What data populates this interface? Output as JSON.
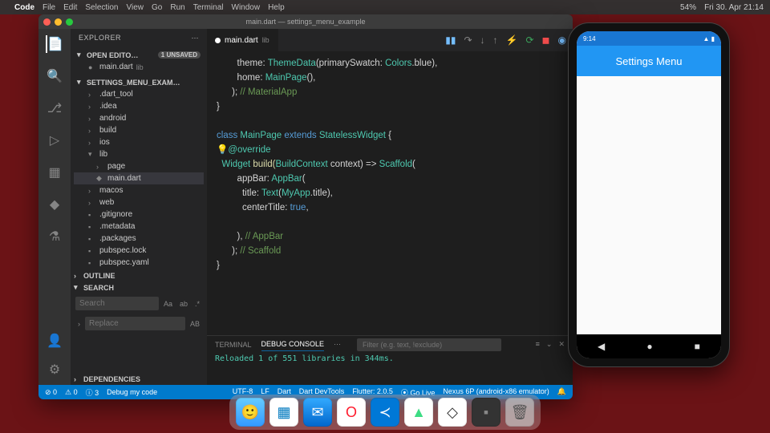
{
  "menubar": {
    "apple": "",
    "app": "Code",
    "items": [
      "File",
      "Edit",
      "Selection",
      "View",
      "Go",
      "Run",
      "Terminal",
      "Window",
      "Help"
    ],
    "right": {
      "time": "Fri 30. Apr 21:14",
      "bat": "54%"
    }
  },
  "vscode": {
    "title": "main.dart — settings_menu_example",
    "sidebar": {
      "header": "EXPLORER",
      "open_editors": {
        "label": "OPEN EDITO…",
        "badge": "1 UNSAVED",
        "file": "main.dart",
        "dir": "lib"
      },
      "project": {
        "label": "SETTINGS_MENU_EXAM…",
        "items": [
          {
            "name": ".dart_tool",
            "folder": true
          },
          {
            "name": ".idea",
            "folder": true
          },
          {
            "name": "android",
            "folder": true
          },
          {
            "name": "build",
            "folder": true
          },
          {
            "name": "ios",
            "folder": true
          },
          {
            "name": "lib",
            "folder": true,
            "open": true,
            "children": [
              {
                "name": "page",
                "folder": true
              },
              {
                "name": "main.dart",
                "folder": false,
                "selected": true
              }
            ]
          },
          {
            "name": "macos",
            "folder": true
          },
          {
            "name": "web",
            "folder": true
          },
          {
            "name": ".gitignore",
            "folder": false
          },
          {
            "name": ".metadata",
            "folder": false
          },
          {
            "name": ".packages",
            "folder": false
          },
          {
            "name": "pubspec.lock",
            "folder": false
          },
          {
            "name": "pubspec.yaml",
            "folder": false
          }
        ]
      },
      "outline": "OUTLINE",
      "search": "SEARCH",
      "search_ph": "Search",
      "replace_ph": "Replace",
      "dependencies": "DEPENDENCIES"
    },
    "tab": {
      "name": "main.dart",
      "dir": "lib"
    },
    "panel": {
      "terminal": "TERMINAL",
      "debug": "DEBUG CONSOLE",
      "filter_ph": "Filter (e.g. text, !exclude)",
      "log": "Reloaded 1 of 551 libraries in 344ms."
    },
    "status": {
      "left": [
        "⊘ 0",
        "⚠ 0",
        "ⓘ 3",
        "Debug my code"
      ],
      "right": [
        "UTF-8",
        "LF",
        "Dart",
        "Dart DevTools",
        "Flutter: 2.0.5",
        "⦿ Go Live",
        "Nexus 6P (android-x86 emulator)",
        "🔔"
      ]
    }
  },
  "phone": {
    "status_l": "9:14",
    "status_r": "▲ ▮",
    "appbar": "Settings Menu",
    "nav": [
      "◀",
      "●",
      "■"
    ]
  },
  "code": {
    "l1a": "        theme: ",
    "l1b": "ThemeData",
    "l1c": "(primarySwatch: ",
    "l1d": "Colors",
    "l1e": ".blue),",
    "l2a": "        home: ",
    "l2b": "MainPage",
    "l2c": "(),",
    "l3a": "      ); ",
    "l3b": "// MaterialApp",
    "l4": "}",
    "l5": "",
    "l6a": "class ",
    "l6b": "MainPage",
    "l6c": " extends ",
    "l6d": "StatelessWidget",
    "l6e": " {",
    "l7a": "  ",
    "l7b": "@override",
    "l8a": "  ",
    "l8b": "Widget",
    "l8c": " build(",
    "l8d": "BuildContext",
    "l8e": " context) => ",
    "l8f": "Scaffold",
    "l8g": "(",
    "l9a": "        appBar: ",
    "l9b": "AppBar",
    "l9c": "(",
    "l10a": "          title: ",
    "l10b": "Text",
    "l10c": "(",
    "l10d": "MyApp",
    "l10e": ".title),",
    "l11a": "          centerTitle: ",
    "l11b": "true",
    "l11c": ",",
    "l12": "",
    "l13a": "        ), ",
    "l13b": "// AppBar",
    "l14a": "      ); ",
    "l14b": "// Scaffold",
    "l15": "}"
  }
}
